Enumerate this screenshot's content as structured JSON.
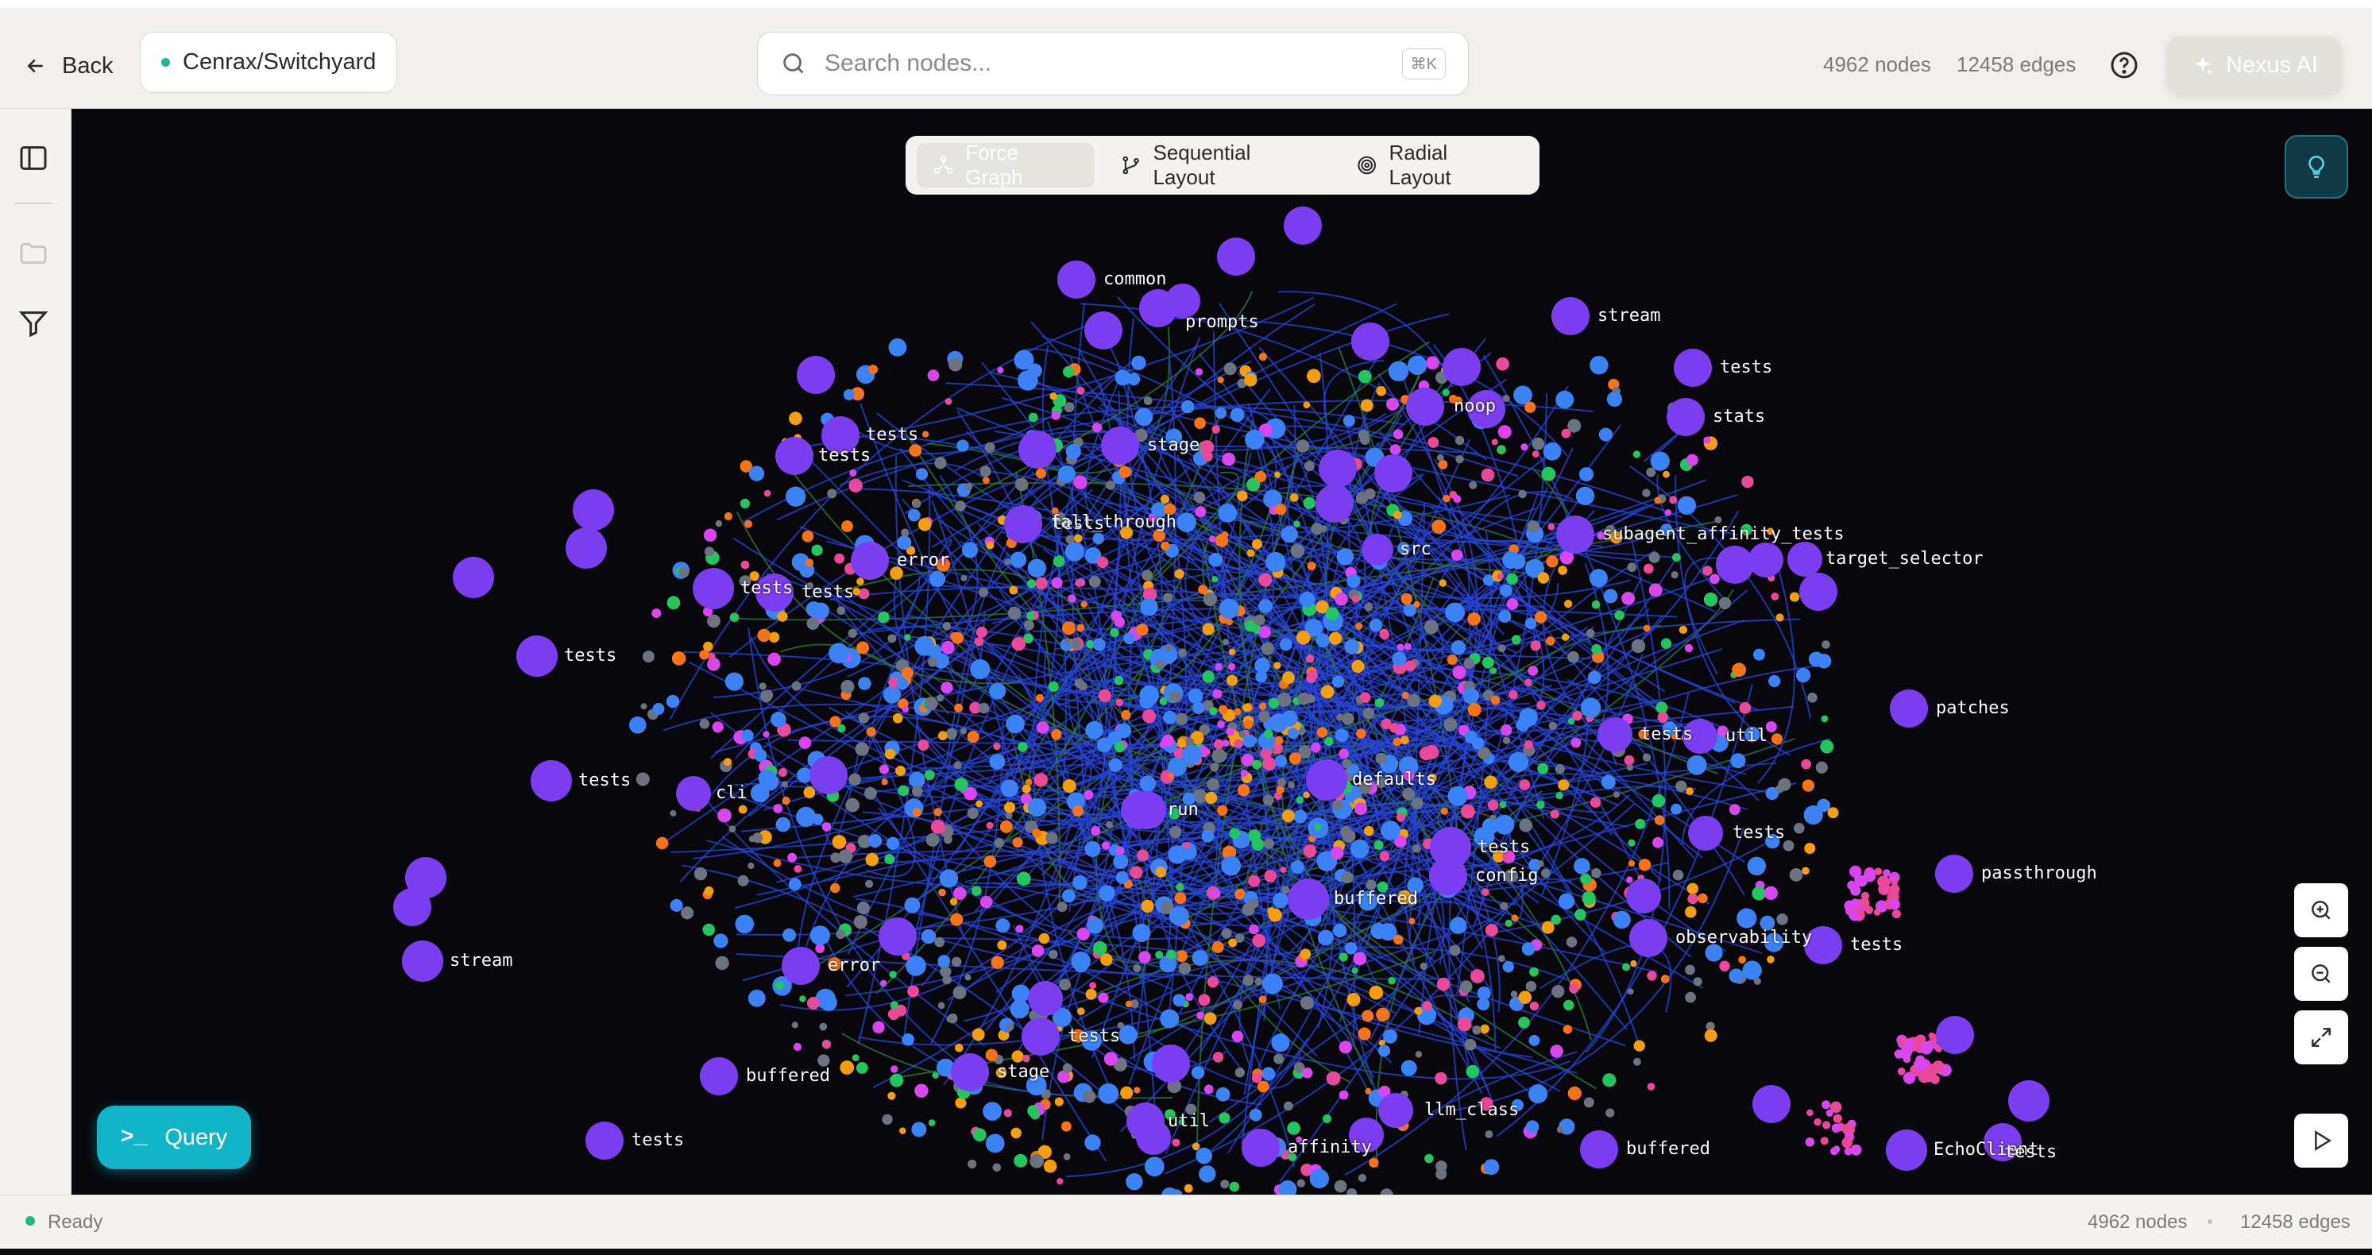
{
  "header": {
    "back_label": "Back",
    "repo_name": "Cenrax/Switchyard",
    "search_placeholder": "Search nodes...",
    "search_shortcut": "⌘K",
    "node_count": "4962 nodes",
    "edge_count": "12458 edges",
    "ai_button_label": "Nexus AI"
  },
  "sidebar": {
    "icons": [
      "panel-toggle-icon",
      "folder-icon",
      "filter-icon"
    ]
  },
  "layout_tabs": [
    {
      "label": "Force Graph",
      "icon": "force-graph-icon",
      "active": true
    },
    {
      "label": "Sequential Layout",
      "icon": "branch-icon",
      "active": false
    },
    {
      "label": "Radial Layout",
      "icon": "radial-icon",
      "active": false
    }
  ],
  "graph": {
    "colors": {
      "cluster": "#7b3df0",
      "file": "#3b82f6",
      "function": "#22c55e",
      "class": "#f97316",
      "method": "#ec4899",
      "variable": "#6b7280",
      "interface": "#d946ef",
      "edge": "#2546d8"
    },
    "labels": [
      "common",
      "prompts",
      "stream",
      "tests",
      "stats",
      "tests",
      "tests",
      "stage",
      "noop",
      "tests",
      "fall_through",
      "src",
      "subagent_affinity_tests",
      "target_selector",
      "error",
      "tests",
      "tests",
      "tests",
      "tests",
      "patches",
      "util",
      "tests",
      "defaults",
      "cli",
      "run",
      "tests",
      "passthrough",
      "stream",
      "buffered",
      "tests",
      "config",
      "error",
      "observability",
      "tests",
      "EchoClient",
      "tests",
      "buffered",
      "stage",
      "llm_class",
      "util",
      "affinity",
      "buffered",
      "tests",
      "tests"
    ]
  },
  "query_button_label": "Query",
  "status": {
    "state": "Ready",
    "node_count": "4962 nodes",
    "edge_count": "12458 edges"
  }
}
